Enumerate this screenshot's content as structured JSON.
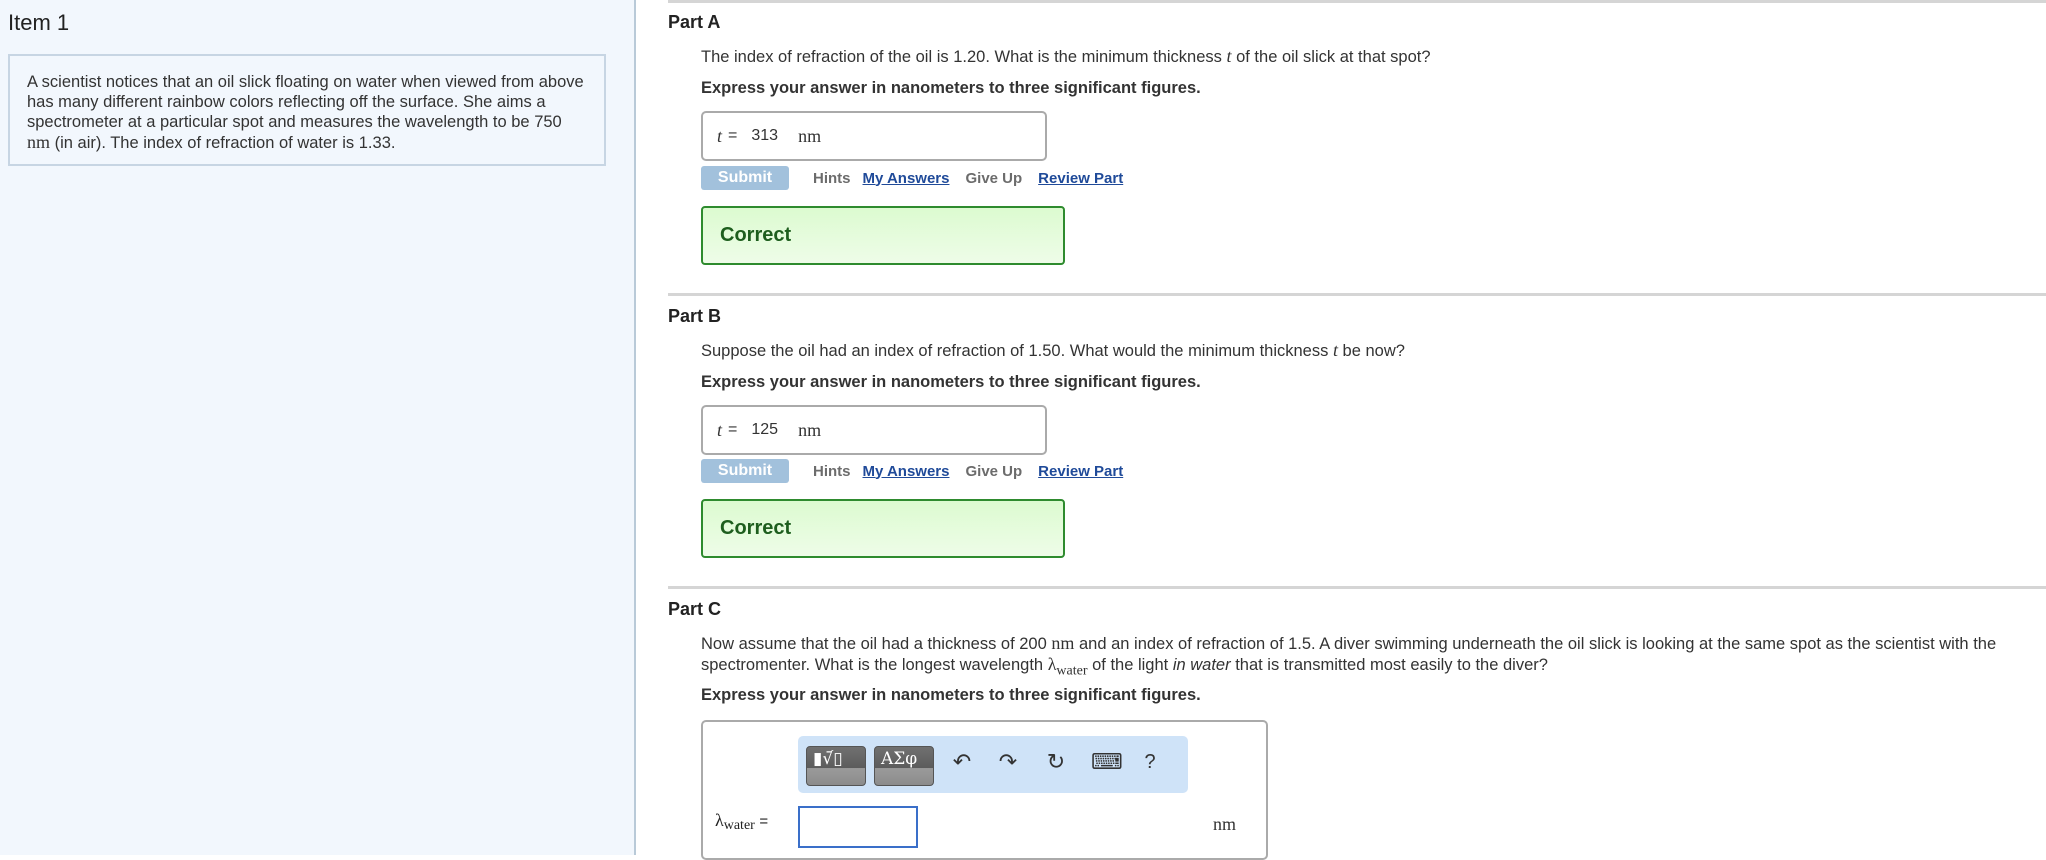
{
  "item": {
    "title": "Item 1",
    "intro_before": "A scientist notices that an oil slick floating on water when viewed from above has many different rainbow colors reflecting off the surface. She aims a spectrometer at a particular spot and measures the wavelength to be 750 ",
    "intro_unit": "nm",
    "intro_after": " (in air). The index of refraction of water is 1.33."
  },
  "parts": [
    {
      "title": "Part A",
      "question_before": "The index of refraction of the oil is 1.20. What is the minimum thickness ",
      "question_var": "t",
      "question_after": " of the oil slick at that spot?",
      "instruction": "Express your answer in nanometers to three significant figures.",
      "answer_var": "t",
      "answer_eq": "=",
      "answer_value": "313",
      "answer_unit": "nm",
      "status": "Correct"
    },
    {
      "title": "Part B",
      "question_before": "Suppose the oil had an index of refraction of 1.50. What would the minimum thickness ",
      "question_var": "t",
      "question_after": " be now?",
      "instruction": "Express your answer in nanometers to three significant figures.",
      "answer_var": "t",
      "answer_eq": "=",
      "answer_value": "125",
      "answer_unit": "nm",
      "status": "Correct"
    },
    {
      "title": "Part C",
      "question_1": "Now assume that the oil had a thickness of 200 ",
      "question_unit": "nm",
      "question_2": " and an index of refraction of 1.5. A diver swimming underneath the oil slick is looking at the same spot as the scientist with the spectromenter. What is the longest wavelength ",
      "question_var": "λ",
      "question_var_sub": "water",
      "question_3": " of the light ",
      "question_italic": "in water",
      "question_4": " that is transmitted most easily to the diver?",
      "instruction": "Express your answer in nanometers to three significant figures.",
      "answer_var": "λ",
      "answer_var_sub": "water",
      "answer_eq": "=",
      "answer_value": "",
      "answer_unit": "nm"
    }
  ],
  "actions": {
    "submit": "Submit",
    "hints": "Hints",
    "my_answers": "My Answers",
    "give_up": "Give Up",
    "review_part": "Review Part"
  },
  "toolbar": {
    "templates_label": "▮√̄▯",
    "symbols_label": "ΑΣφ",
    "undo_icon": "↶",
    "redo_icon": "↷",
    "reset_icon": "↻",
    "keyboard_icon": "⌨",
    "help_icon": "?"
  },
  "colors": {
    "link": "#1f4a99",
    "submit_disabled": "#a2c1dc",
    "correct_border": "#2e8b2e",
    "correct_text": "#1e5e1e",
    "left_panel_bg": "#f2f7fd",
    "toolbar_bg": "#cfe3f8"
  }
}
